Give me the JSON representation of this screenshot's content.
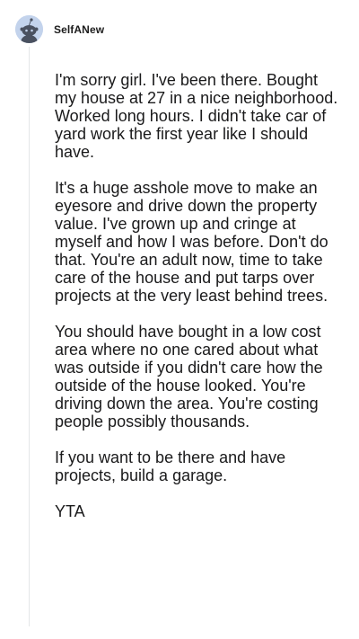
{
  "comment": {
    "username": "SelfANew",
    "avatar_icon": "snoo-avatar-icon",
    "paragraphs": [
      "I'm sorry girl. I've been there. Bought my house at 27 in a nice neighborhood. Worked long hours. I didn't take car of yard work the first year like I should have.",
      "It's a huge asshole move to make an eyesore and drive down the property value. I've grown up and cringe at myself and how I was before. Don't do that. You're an adult now, time to take care of the house and put tarps over projects at the very least behind trees.",
      "You should have bought in a low cost area where no one cared about what was outside if you didn't care how the outside of the house looked. You're driving down the area. You're costing people possibly thousands.",
      "If you want to be there and have projects, build a garage.",
      "YTA"
    ]
  },
  "colors": {
    "avatar_bg": "#c3d3ec",
    "text": "#1a1a1b",
    "thread_line": "#e4e6e8"
  }
}
